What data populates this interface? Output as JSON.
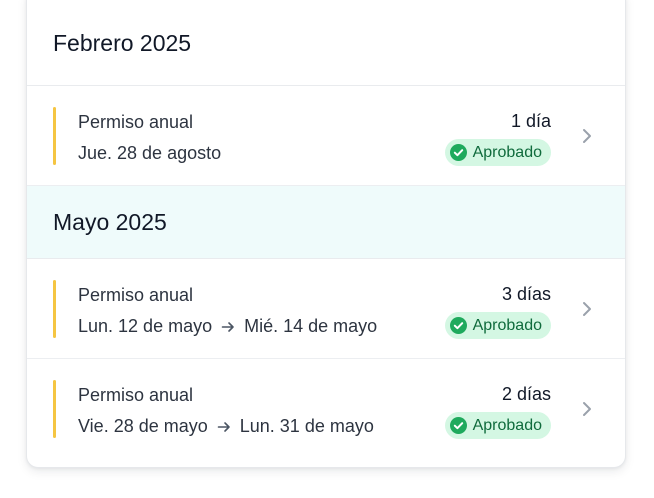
{
  "sections": [
    {
      "title": "Febrero 2025",
      "entries": [
        {
          "type": "Permiso anual",
          "start": "Jue. 28 de agosto",
          "end": "",
          "days": "1 día",
          "status": "Aprobado"
        }
      ]
    },
    {
      "title": "Mayo 2025",
      "entries": [
        {
          "type": "Permiso anual",
          "start": "Lun. 12 de mayo",
          "end": "Mié. 14 de mayo",
          "days": "3 días",
          "status": "Aprobado"
        },
        {
          "type": "Permiso anual",
          "start": "Vie. 28 de mayo",
          "end": "Lun. 31 de mayo",
          "days": "2 días",
          "status": "Aprobado"
        }
      ]
    }
  ],
  "colors": {
    "accent_bar": "#f5c542",
    "highlight_section_bg": "#effbfb",
    "status_bg": "#d4f7e3",
    "status_text": "#0f6b3c",
    "status_icon": "#1faa5d"
  },
  "icons": {
    "status": "check-circle-icon",
    "range_separator": "arrow-right-icon",
    "row_action": "chevron-right-icon"
  }
}
